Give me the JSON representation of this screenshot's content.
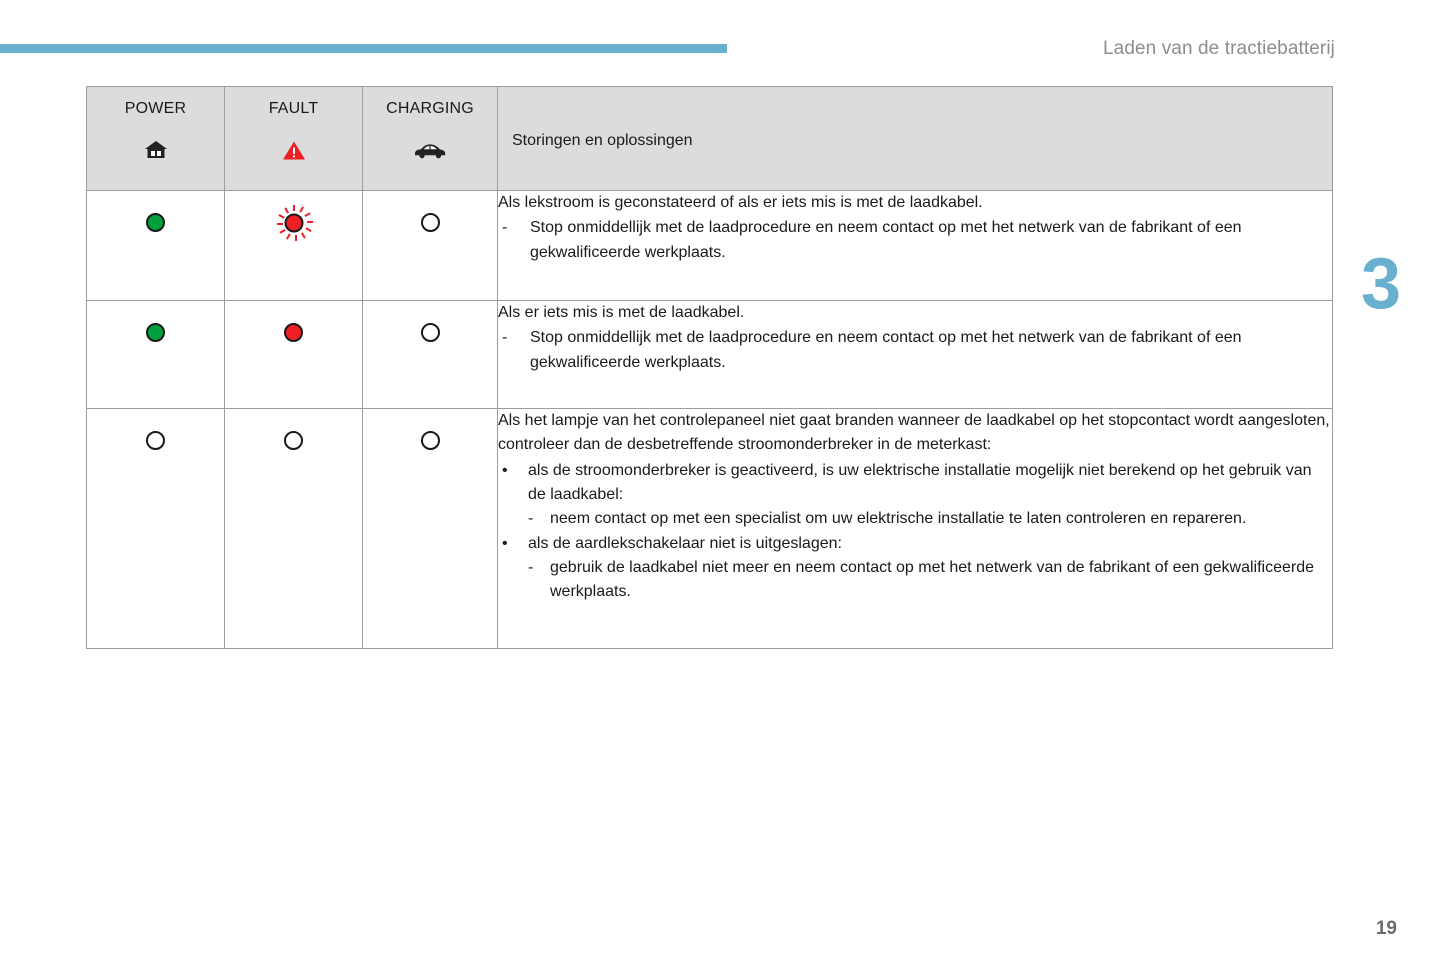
{
  "header": {
    "title": "Laden van de tractiebatterij",
    "bar_color": "#69b0ce"
  },
  "chapter": {
    "number": "3",
    "color": "#69b0ce"
  },
  "footer": {
    "page_number": "19"
  },
  "table": {
    "columns": [
      {
        "label": "POWER",
        "icon": "house-icon"
      },
      {
        "label": "FAULT",
        "icon": "warning-triangle-icon"
      },
      {
        "label": "CHARGING",
        "icon": "car-icon"
      }
    ],
    "description_header": "Storingen en oplossingen",
    "colors": {
      "header_background": "#dcdcdc",
      "border": "#9d9d9d",
      "led_green": "#00a03c",
      "led_red": "#ed2024",
      "led_off": "#ffffff"
    },
    "rows": [
      {
        "power": "green",
        "fault": "red-blinking",
        "charging": "off",
        "intro": "Als lekstroom is geconstateerd of als er iets mis is met de laadkabel.",
        "dash_marker": "-",
        "dash_text": "Stop onmiddellijk met de laadprocedure en neem contact op met het netwerk van de fabrikant of een gekwalificeerde werkplaats."
      },
      {
        "power": "green",
        "fault": "red",
        "charging": "off",
        "intro": "Als er iets mis is met de laadkabel.",
        "dash_marker": "-",
        "dash_text": "Stop onmiddellijk met de laadprocedure en neem contact op met het netwerk van de fabrikant of een gekwalificeerde werkplaats."
      },
      {
        "power": "off",
        "fault": "off",
        "charging": "off",
        "intro": "Als het lampje van het controlepaneel niet gaat branden wanneer de laadkabel op het stopcontact wordt aangesloten, controleer dan de desbetreffende stroomonderbreker in de meterkast:",
        "bullet_marker": "•",
        "dash_marker": "-",
        "bullet1_text": "als de stroomonderbreker is geactiveerd, is uw elektrische installatie mogelijk niet berekend op het gebruik van de laadkabel:",
        "bullet1_sub_text": "neem contact op met een specialist om uw elektrische installatie te laten controleren en repareren.",
        "bullet2_text": "als de aardlekschakelaar niet is uitgeslagen:",
        "bullet2_sub_text": "gebruik de laadkabel niet meer en neem contact op met het netwerk van de fabrikant of een gekwalificeerde werkplaats."
      }
    ]
  }
}
